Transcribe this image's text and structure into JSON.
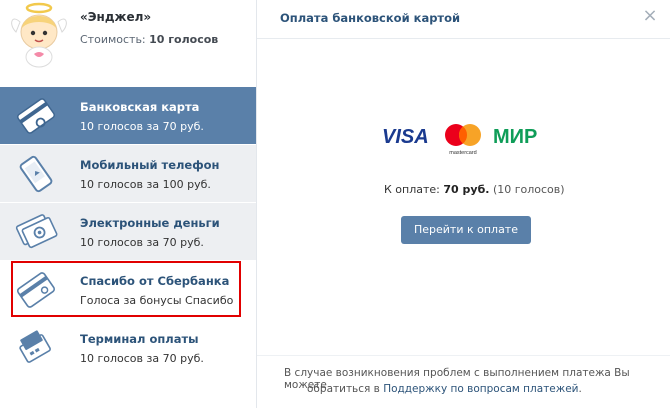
{
  "sticker": {
    "name": "«Энджел»",
    "cost_label": "Стоимость:",
    "cost_value": "10 голосов"
  },
  "methods": [
    {
      "title": "Банковская карта",
      "subtitle": "10 голосов за 70 руб.",
      "icon": "bank-card-icon",
      "active": true
    },
    {
      "title": "Мобильный телефон",
      "subtitle": "10 голосов за 100 руб.",
      "icon": "mobile-phone-icon",
      "active": false
    },
    {
      "title": "Электронные деньги",
      "subtitle": "10 голосов за 70 руб.",
      "icon": "e-money-icon",
      "active": false
    },
    {
      "title": "Спасибо от Сбербанка",
      "subtitle": "Голоса за бонусы Спасибо",
      "icon": "sberbank-card-icon",
      "active": false
    },
    {
      "title": "Терминал оплаты",
      "subtitle": "10 голосов за 70 руб.",
      "icon": "payment-terminal-icon",
      "active": false
    }
  ],
  "panel": {
    "title": "Оплата банковской картой",
    "close": "×",
    "logos": {
      "visa": "VISA",
      "mastercard": "mastercard",
      "mir": "МИР"
    },
    "amount_label": "К оплате:",
    "amount_value": "70 руб.",
    "amount_note": "(10 голосов)",
    "pay_button": "Перейти к оплате",
    "help_line1": "В случае возникновения проблем с выполнением платежа Вы можете",
    "help_line2_prefix": "обратиться в",
    "help_link": "Поддержку по вопросам платежей",
    "help_line2_suffix": "."
  },
  "colors": {
    "accent": "#5a80a9",
    "link": "#2c5379",
    "highlight": "#e10000"
  }
}
